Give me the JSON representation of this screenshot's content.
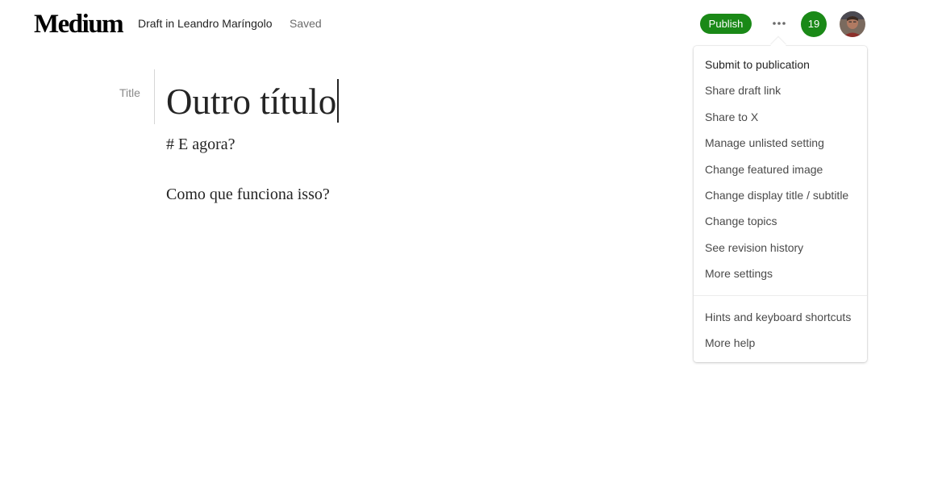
{
  "header": {
    "logo": "Medium",
    "draft_info": "Draft in Leandro Maríngolo",
    "status": "Saved",
    "publish_label": "Publish",
    "notification_count": "19",
    "accent_color": "#1a8917"
  },
  "icons": {
    "more": "more-horizontal-icon",
    "avatar": "user-avatar"
  },
  "editor": {
    "title_label": "Title",
    "title": "Outro título",
    "body": [
      "# E agora?",
      "Como que funciona isso?"
    ]
  },
  "menu": {
    "items": [
      "Submit to publication",
      "Share draft link",
      "Share to X",
      "Manage unlisted setting",
      "Change featured image",
      "Change display title / subtitle",
      "Change topics",
      "See revision history",
      "More settings"
    ],
    "help_items": [
      "Hints and keyboard shortcuts",
      "More help"
    ]
  }
}
